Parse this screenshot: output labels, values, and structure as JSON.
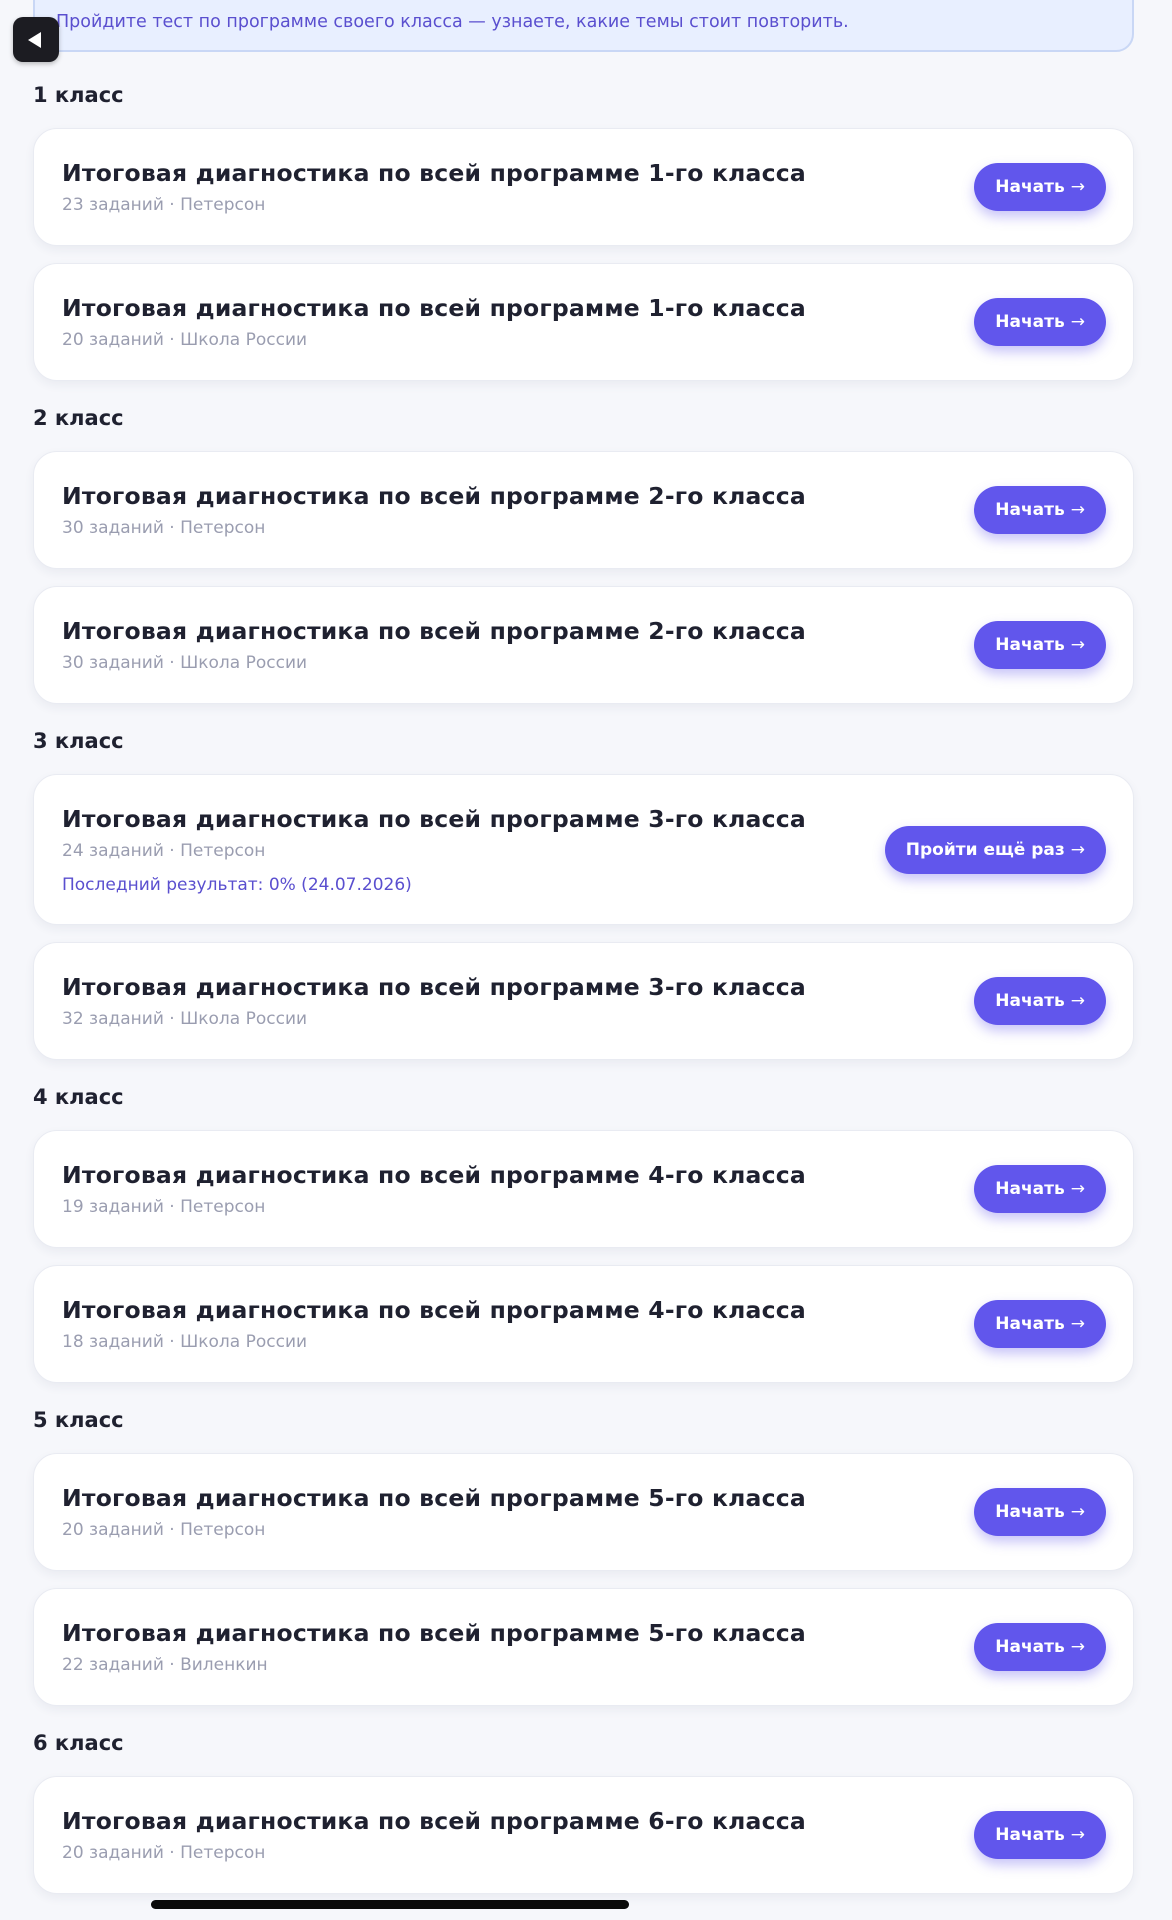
{
  "banner": {
    "text": "Пройдите тест по программе своего класса — узнаете, какие темы стоит повторить."
  },
  "arrow": "→",
  "grades": [
    {
      "heading": "1 класс",
      "tests": [
        {
          "title": "Итоговая диагностика по всей программе 1-го класса",
          "meta": "23 заданий · Петерсон",
          "button": "Начать"
        },
        {
          "title": "Итоговая диагностика по всей программе 1-го класса",
          "meta": "20 заданий · Школа России",
          "button": "Начать"
        }
      ]
    },
    {
      "heading": "2 класс",
      "tests": [
        {
          "title": "Итоговая диагностика по всей программе 2-го класса",
          "meta": "30 заданий · Петерсон",
          "button": "Начать"
        },
        {
          "title": "Итоговая диагностика по всей программе 2-го класса",
          "meta": "30 заданий · Школа России",
          "button": "Начать"
        }
      ]
    },
    {
      "heading": "3 класс",
      "tests": [
        {
          "title": "Итоговая диагностика по всей программе 3-го класса",
          "meta": "24 заданий · Петерсон",
          "result": "Последний результат: 0% (24.07.2026)",
          "button": "Пройти ещё раз"
        },
        {
          "title": "Итоговая диагностика по всей программе 3-го класса",
          "meta": "32 заданий · Школа России",
          "button": "Начать"
        }
      ]
    },
    {
      "heading": "4 класс",
      "tests": [
        {
          "title": "Итоговая диагностика по всей программе 4-го класса",
          "meta": "19 заданий · Петерсон",
          "button": "Начать"
        },
        {
          "title": "Итоговая диагностика по всей программе 4-го класса",
          "meta": "18 заданий · Школа России",
          "button": "Начать"
        }
      ]
    },
    {
      "heading": "5 класс",
      "tests": [
        {
          "title": "Итоговая диагностика по всей программе 5-го класса",
          "meta": "20 заданий · Петерсон",
          "button": "Начать"
        },
        {
          "title": "Итоговая диагностика по всей программе 5-го класса",
          "meta": "22 заданий · Виленкин",
          "button": "Начать"
        }
      ]
    },
    {
      "heading": "6 класс",
      "tests": [
        {
          "title": "Итоговая диагностика по всей программе 6-го класса",
          "meta": "20 заданий · Петерсон",
          "button": "Начать"
        }
      ]
    }
  ]
}
